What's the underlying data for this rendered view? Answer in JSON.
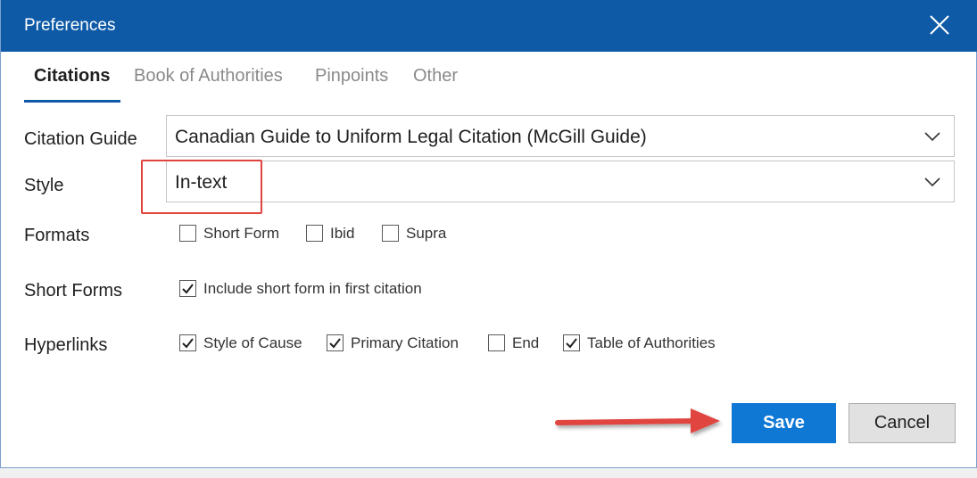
{
  "window": {
    "title": "Preferences"
  },
  "tabs": [
    {
      "label": "Citations",
      "active": true
    },
    {
      "label": "Book of Authorities",
      "active": false
    },
    {
      "label": "Pinpoints",
      "active": false
    },
    {
      "label": "Other",
      "active": false
    }
  ],
  "citation_guide": {
    "label": "Citation Guide",
    "value": "Canadian Guide to Uniform Legal Citation (McGill Guide)"
  },
  "style": {
    "label": "Style",
    "value": "In-text"
  },
  "formats": {
    "label": "Formats",
    "options": [
      {
        "label": "Short Form",
        "checked": false
      },
      {
        "label": "Ibid",
        "checked": false
      },
      {
        "label": "Supra",
        "checked": false
      }
    ]
  },
  "short_forms": {
    "label": "Short Forms",
    "options": [
      {
        "label": "Include short form in first citation",
        "checked": true
      }
    ]
  },
  "hyperlinks": {
    "label": "Hyperlinks",
    "options": [
      {
        "label": "Style of Cause",
        "checked": true
      },
      {
        "label": "Primary Citation",
        "checked": true
      },
      {
        "label": "End",
        "checked": false
      },
      {
        "label": "Table of Authorities",
        "checked": true
      }
    ]
  },
  "buttons": {
    "save": "Save",
    "cancel": "Cancel"
  },
  "colors": {
    "titlebar": "#0e5aa7",
    "accent": "#0f78d4",
    "annotation": "#e0443f"
  },
  "icons": {
    "close": "close-icon",
    "chevron": "chevron-down-icon",
    "check": "checkmark-icon"
  }
}
